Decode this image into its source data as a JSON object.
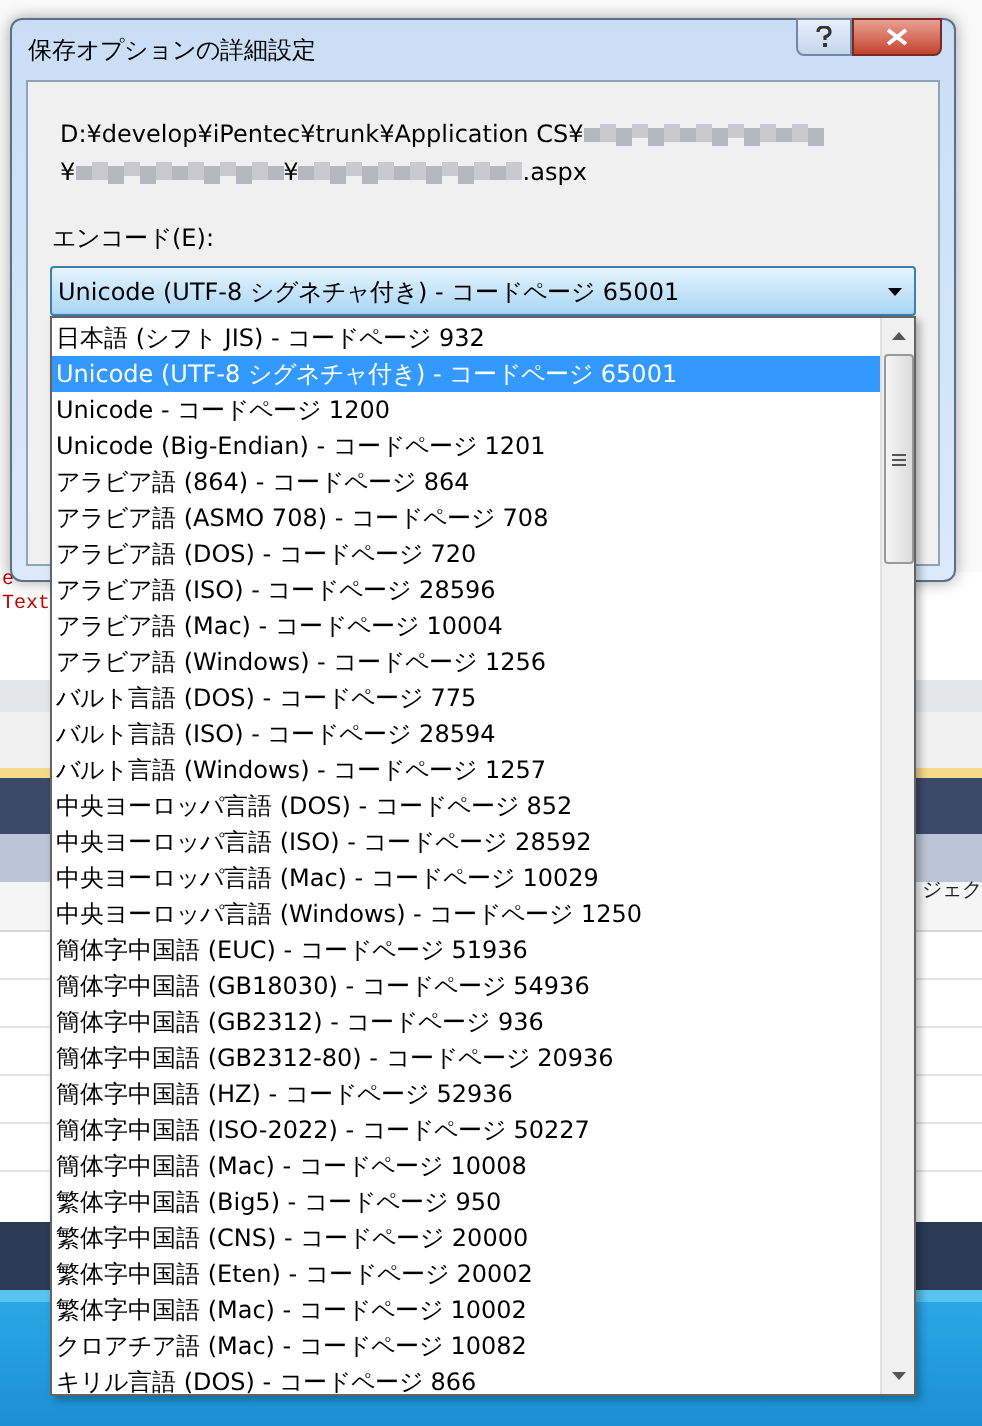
{
  "background": {
    "fragments": [
      {
        "text": "e",
        "kind": "red"
      },
      {
        "text": "Text",
        "kind": "red"
      },
      {
        "text": "ジェク",
        "kind": "header"
      }
    ]
  },
  "dialog": {
    "title": "保存オプションの詳細設定",
    "path_lines": [
      [
        {
          "kind": "text",
          "text": "D:¥develop¥iPentec¥trunk¥Application CS¥"
        },
        {
          "kind": "redacted"
        }
      ],
      [
        {
          "kind": "text",
          "text": "¥"
        },
        {
          "kind": "redacted"
        },
        {
          "kind": "text",
          "text": "¥"
        },
        {
          "kind": "redacted"
        },
        {
          "kind": "text",
          "text": ".aspx"
        }
      ]
    ],
    "encoding_label": "エンコード(E):",
    "encoding_value": "Unicode (UTF-8 シグネチャ付き) - コードページ 65001",
    "options": [
      {
        "label": "日本語 (シフト JIS) - コードページ 932",
        "selected": false
      },
      {
        "label": "Unicode (UTF-8 シグネチャ付き) - コードページ 65001",
        "selected": true
      },
      {
        "label": "Unicode - コードページ 1200",
        "selected": false
      },
      {
        "label": "Unicode (Big-Endian) - コードページ 1201",
        "selected": false
      },
      {
        "label": "アラビア語 (864) - コードページ 864",
        "selected": false
      },
      {
        "label": "アラビア語 (ASMO 708) - コードページ 708",
        "selected": false
      },
      {
        "label": "アラビア語 (DOS) - コードページ 720",
        "selected": false
      },
      {
        "label": "アラビア語 (ISO) - コードページ 28596",
        "selected": false
      },
      {
        "label": "アラビア語 (Mac) - コードページ 10004",
        "selected": false
      },
      {
        "label": "アラビア語 (Windows) - コードページ 1256",
        "selected": false
      },
      {
        "label": "バルト言語 (DOS) - コードページ 775",
        "selected": false
      },
      {
        "label": "バルト言語 (ISO) - コードページ 28594",
        "selected": false
      },
      {
        "label": "バルト言語 (Windows) - コードページ 1257",
        "selected": false
      },
      {
        "label": "中央ヨーロッパ言語 (DOS) - コードページ 852",
        "selected": false
      },
      {
        "label": "中央ヨーロッパ言語 (ISO) - コードページ 28592",
        "selected": false
      },
      {
        "label": "中央ヨーロッパ言語 (Mac) - コードページ 10029",
        "selected": false
      },
      {
        "label": "中央ヨーロッパ言語 (Windows) - コードページ 1250",
        "selected": false
      },
      {
        "label": "簡体字中国語 (EUC) - コードページ 51936",
        "selected": false
      },
      {
        "label": "簡体字中国語 (GB18030) - コードページ 54936",
        "selected": false
      },
      {
        "label": "簡体字中国語 (GB2312) - コードページ 936",
        "selected": false
      },
      {
        "label": "簡体字中国語 (GB2312-80) - コードページ 20936",
        "selected": false
      },
      {
        "label": "簡体字中国語 (HZ) - コードページ 52936",
        "selected": false
      },
      {
        "label": "簡体字中国語 (ISO-2022) - コードページ 50227",
        "selected": false
      },
      {
        "label": "簡体字中国語 (Mac) - コードページ 10008",
        "selected": false
      },
      {
        "label": "繁体字中国語 (Big5) - コードページ 950",
        "selected": false
      },
      {
        "label": "繁体字中国語 (CNS) - コードページ 20000",
        "selected": false
      },
      {
        "label": "繁体字中国語 (Eten) - コードページ 20002",
        "selected": false
      },
      {
        "label": "繁体字中国語 (Mac) - コードページ 10002",
        "selected": false
      },
      {
        "label": "クロアチア語 (Mac) - コードページ 10082",
        "selected": false
      },
      {
        "label": "キリル言語 (DOS) - コードページ 866",
        "selected": false
      }
    ]
  }
}
